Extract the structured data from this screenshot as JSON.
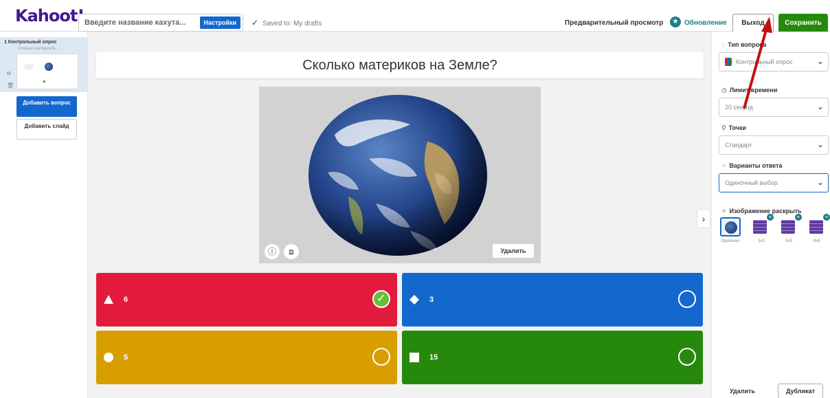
{
  "header": {
    "logo": "Kahoot!",
    "title_placeholder": "Введите название кахута...",
    "settings_label": "Настройки",
    "saved_status": "Saved to: My drafts",
    "preview_label": "Предварительный просмотр",
    "update_label": "Обновление",
    "exit_label": "Выход",
    "save_label": "Сохранить"
  },
  "sidebar": {
    "slide_number_title": "1 Контрольный опрос",
    "slide_subtitle": "Сколько материков...",
    "add_question_label": "Добавить вопрос",
    "add_slide_label": "Добавить слайд"
  },
  "question": {
    "text": "Сколько материков на Земле?",
    "delete_image_label": "Удалить"
  },
  "answers": [
    {
      "text": "6",
      "color": "#e21b3c",
      "shape": "triangle",
      "correct": true
    },
    {
      "text": "3",
      "color": "#1368ce",
      "shape": "diamond",
      "correct": false
    },
    {
      "text": "5",
      "color": "#d89e00",
      "shape": "circle",
      "correct": false
    },
    {
      "text": "15",
      "color": "#26890c",
      "shape": "square",
      "correct": false
    }
  ],
  "settings_panel": {
    "question_type_label": "Тип вопроса",
    "question_type_value": "Контрольный опрос",
    "time_limit_label": "Лимит времени",
    "time_limit_value": "20 секунд",
    "points_label": "Точки",
    "points_value": "Стандарт",
    "answer_options_label": "Варианты ответа",
    "answer_options_value": "Одиночный выбор",
    "image_reveal_label": "Изображение раскрыть",
    "reveal_options": [
      "Оригинал",
      "3x3",
      "5x5",
      "8x8"
    ],
    "delete_label": "Удалить",
    "duplicate_label": "Дубликат"
  }
}
